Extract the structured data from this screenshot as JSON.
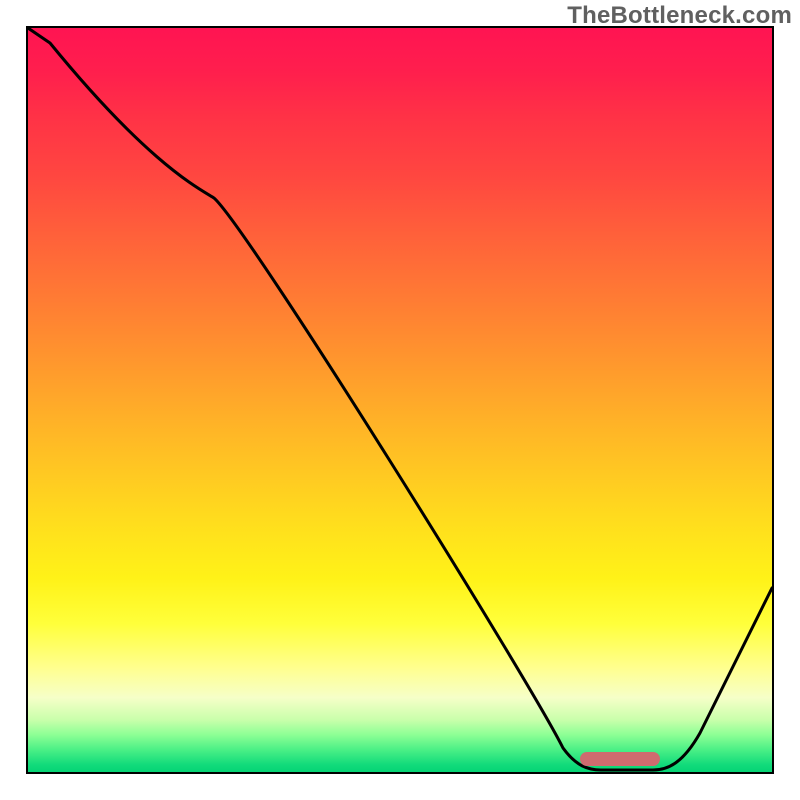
{
  "watermark": "TheBottleneck.com",
  "colors": {
    "frame": "#000000",
    "curve": "#000000",
    "marker": "#cf6b6f",
    "gradient_top": "#ff1452",
    "gradient_bottom": "#05d475"
  },
  "chart_data": {
    "type": "line",
    "title": "",
    "xlabel": "",
    "ylabel": "",
    "xlim": [
      0,
      100
    ],
    "ylim": [
      0,
      100
    ],
    "x": [
      0,
      3,
      25,
      72,
      77,
      84,
      100
    ],
    "y": [
      100,
      98,
      78,
      3,
      0,
      0,
      25
    ],
    "marker_segment": {
      "x_start": 74,
      "x_end": 85,
      "y": 1
    },
    "annotations": [],
    "legend": []
  }
}
